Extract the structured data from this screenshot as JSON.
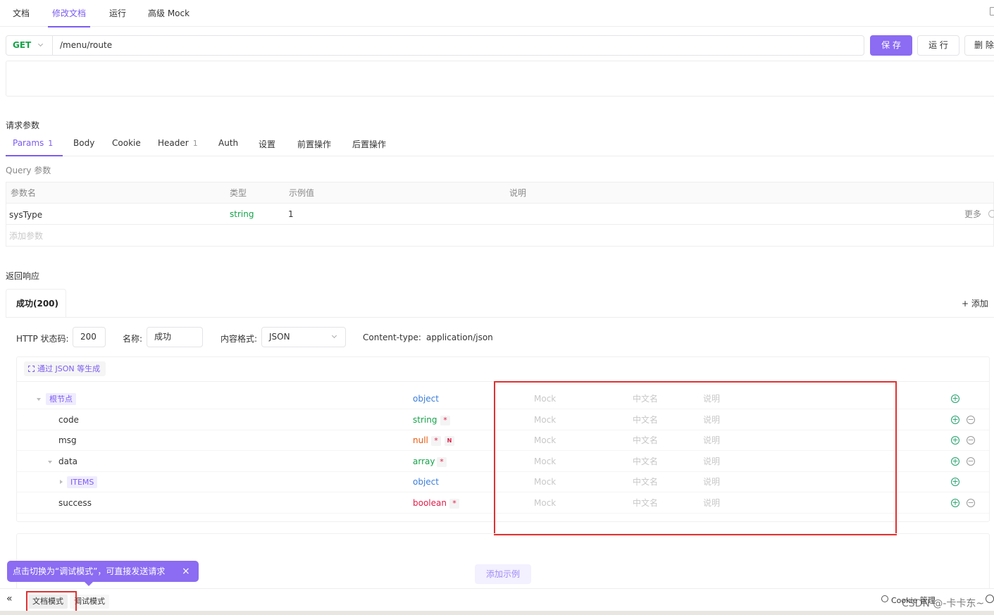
{
  "top_tabs": [
    "文档",
    "修改文档",
    "运行",
    "高级 Mock"
  ],
  "request": {
    "method": "GET",
    "url": "/menu/route",
    "save": "保 存",
    "run": "运 行",
    "delete": "删 除"
  },
  "params_section": {
    "title": "请求参数",
    "tabs": [
      {
        "label": "Params",
        "count": "1"
      },
      {
        "label": "Body",
        "count": ""
      },
      {
        "label": "Cookie",
        "count": ""
      },
      {
        "label": "Header",
        "count": "1"
      },
      {
        "label": "Auth",
        "count": ""
      },
      {
        "label": "设置",
        "count": ""
      },
      {
        "label": "前置操作",
        "count": ""
      },
      {
        "label": "后置操作",
        "count": ""
      }
    ],
    "query_label": "Query 参数",
    "columns": [
      "参数名",
      "类型",
      "示例值",
      "说明"
    ],
    "rows": [
      {
        "name": "sysType",
        "type": "string",
        "example": "1",
        "more": "更多"
      }
    ],
    "add_placeholder": "添加参数"
  },
  "response_section": {
    "title": "返回响应",
    "tab": "成功(200)",
    "add": "+ 添加",
    "status_label": "HTTP 状态码:",
    "status": "200",
    "name_label": "名称:",
    "name": "成功",
    "format_label": "内容格式:",
    "format": "JSON",
    "content_type_label": "Content-type:",
    "content_type": "application/json",
    "gen_button": "通过 JSON 等生成",
    "schema_placeholders": {
      "mock": "Mock",
      "cn": "中文名",
      "desc": "说明"
    },
    "schema": [
      {
        "name": "根节点",
        "type": "object",
        "type_color": "#3b7dd8",
        "tag": true,
        "required": false,
        "nullable": false,
        "expand": "down",
        "removable": false
      },
      {
        "name": "code",
        "type": "string",
        "type_color": "#16a34a",
        "tag": false,
        "required": true,
        "nullable": false,
        "expand": "",
        "removable": true
      },
      {
        "name": "msg",
        "type": "null",
        "type_color": "#ea580c",
        "tag": false,
        "required": true,
        "nullable": true,
        "expand": "",
        "removable": true
      },
      {
        "name": "data",
        "type": "array",
        "type_color": "#16a34a",
        "tag": false,
        "required": true,
        "nullable": false,
        "expand": "down",
        "removable": true
      },
      {
        "name": "ITEMS",
        "type": "object",
        "type_color": "#3b7dd8",
        "tag": true,
        "required": false,
        "nullable": false,
        "expand": "right",
        "removable": false
      },
      {
        "name": "success",
        "type": "boolean",
        "type_color": "#e11d48",
        "tag": false,
        "required": true,
        "nullable": false,
        "expand": "",
        "removable": true
      }
    ],
    "add_example": "添加示例"
  },
  "tooltip": {
    "text": "点击切换为“调试模式”，可直接发送请求",
    "close": "×"
  },
  "bottom_bar": {
    "collapse": "«",
    "doc_mode": "文档模式",
    "debug_mode": "调试模式",
    "cookie": "Cookie 管理",
    "watermark": "CSDN @-卡卡东~"
  },
  "colors": {
    "accent": "#8b6cf2",
    "get": "#16a34a",
    "annotation": "#e03131"
  }
}
